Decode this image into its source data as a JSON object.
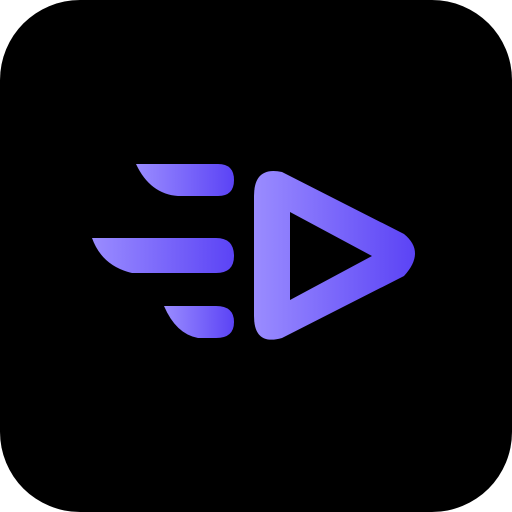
{
  "icon": {
    "name": "fast-forward-play-icon",
    "background_color": "#000000",
    "gradient_start_color": "#9a8cff",
    "gradient_end_color": "#5b43f5"
  }
}
